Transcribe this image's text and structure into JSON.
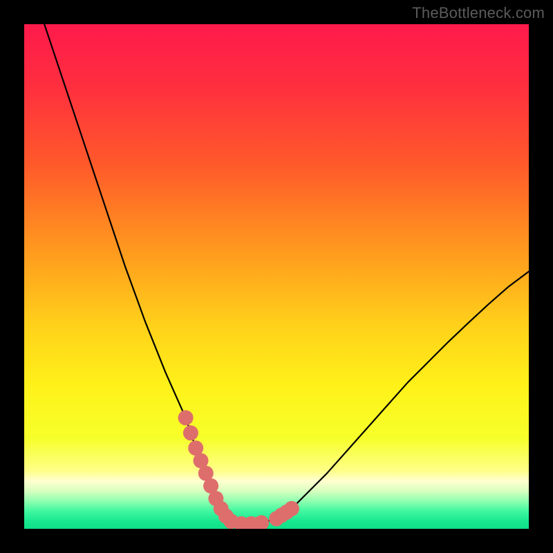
{
  "watermark": {
    "text": "TheBottleneck.com"
  },
  "colors": {
    "black": "#000000",
    "curve": "#000000",
    "marker": "#de6e6c",
    "gradient_stops": [
      {
        "offset": 0.0,
        "color": "#ff1a4b"
      },
      {
        "offset": 0.12,
        "color": "#ff2e3f"
      },
      {
        "offset": 0.28,
        "color": "#ff5a2a"
      },
      {
        "offset": 0.45,
        "color": "#ff9a1e"
      },
      {
        "offset": 0.6,
        "color": "#ffd21a"
      },
      {
        "offset": 0.72,
        "color": "#fff21a"
      },
      {
        "offset": 0.82,
        "color": "#f6ff2a"
      },
      {
        "offset": 0.885,
        "color": "#ffff88"
      },
      {
        "offset": 0.905,
        "color": "#ffffd0"
      },
      {
        "offset": 0.925,
        "color": "#d8ffc0"
      },
      {
        "offset": 0.945,
        "color": "#90ffb0"
      },
      {
        "offset": 0.965,
        "color": "#40f7a0"
      },
      {
        "offset": 0.985,
        "color": "#18e890"
      },
      {
        "offset": 1.0,
        "color": "#10df88"
      }
    ]
  },
  "chart_data": {
    "type": "line",
    "title": "",
    "xlabel": "",
    "ylabel": "",
    "xlim": [
      0,
      100
    ],
    "ylim": [
      0,
      100
    ],
    "series": [
      {
        "name": "bottleneck-curve",
        "x": [
          4,
          6,
          8,
          10,
          12,
          14,
          16,
          18,
          20,
          22,
          24,
          26,
          28,
          30,
          32,
          33,
          34,
          35,
          36,
          37,
          38,
          39,
          40,
          41,
          43,
          45,
          47,
          50,
          53,
          56,
          60,
          64,
          68,
          72,
          76,
          80,
          84,
          88,
          92,
          96,
          100
        ],
        "y": [
          100,
          94,
          88,
          82,
          76,
          70,
          64,
          58,
          52,
          46.5,
          41,
          36,
          31,
          26.5,
          22,
          19,
          16,
          13.5,
          11,
          8.5,
          6,
          4,
          2.5,
          1.5,
          1,
          1,
          1.2,
          2,
          4,
          7,
          11,
          15.5,
          20,
          24.5,
          29,
          33,
          37,
          40.8,
          44.5,
          48,
          51
        ]
      }
    ],
    "markers": {
      "name": "highlight-band",
      "x": [
        32,
        33,
        34,
        35,
        36,
        37,
        38,
        39,
        40,
        41,
        43,
        45,
        47,
        50,
        51,
        52,
        53
      ],
      "y": [
        22,
        19,
        16,
        13.5,
        11,
        8.5,
        6,
        4,
        2.5,
        1.5,
        1,
        1,
        1.2,
        2,
        2.7,
        3.3,
        4
      ],
      "marker_size": 11
    }
  }
}
